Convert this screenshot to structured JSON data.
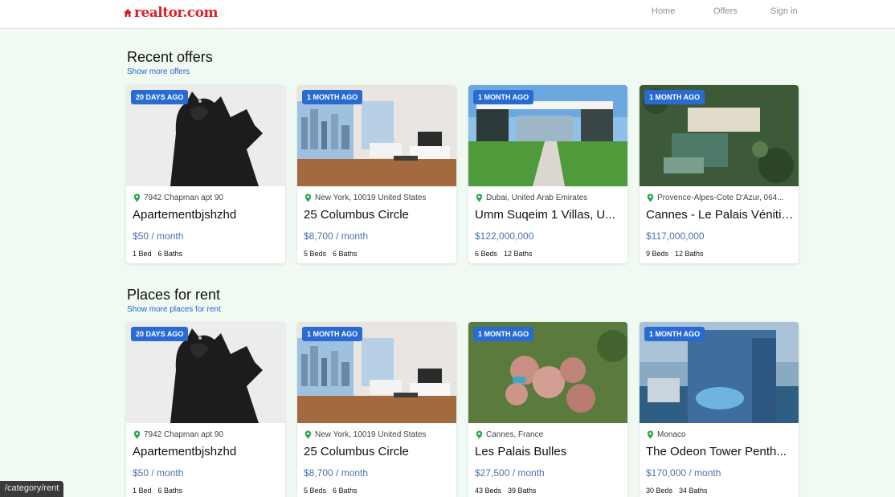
{
  "header": {
    "brand": "realtor.com",
    "nav": [
      "Home",
      "Offers",
      "Sign in"
    ]
  },
  "sections": [
    {
      "title": "Recent offers",
      "link": "Show more offers",
      "cards": [
        {
          "badge": "20 DAYS AGO",
          "location": "7942 Chapman apt 90",
          "title": "Apartementbjshzhd",
          "price": "$50 / month",
          "beds": "1 Bed",
          "baths": "6 Baths",
          "image": "costume-photo"
        },
        {
          "badge": "1 MONTH AGO",
          "location": "New York, 10019 United States",
          "title": "25 Columbus Circle",
          "price": "$8,700 / month",
          "beds": "5 Beds",
          "baths": "6 Baths",
          "image": "apartment-interior-photo"
        },
        {
          "badge": "1 MONTH AGO",
          "location": "Dubai, United Arab Emirates",
          "title": "Umm Suqeim 1 Villas, U...",
          "price": "$122,000,000",
          "beds": "6 Beds",
          "baths": "12 Baths",
          "image": "modern-villa-photo"
        },
        {
          "badge": "1 MONTH AGO",
          "location": "Provence-Alpes-Cote D'Azur, 064...",
          "title": "Cannes - Le Palais Vénitien",
          "price": "$117,000,000",
          "beds": "9 Beds",
          "baths": "12 Baths",
          "image": "palace-aerial-photo"
        }
      ]
    },
    {
      "title": "Places for rent",
      "link": "Show more places for rent",
      "cards": [
        {
          "badge": "20 DAYS AGO",
          "location": "7942 Chapman apt 90",
          "title": "Apartementbjshzhd",
          "price": "$50 / month",
          "beds": "1 Bed",
          "baths": "6 Baths",
          "image": "costume-photo"
        },
        {
          "badge": "1 MONTH AGO",
          "location": "New York, 10019 United States",
          "title": "25 Columbus Circle",
          "price": "$8,700 / month",
          "beds": "5 Beds",
          "baths": "6 Baths",
          "image": "apartment-interior-photo"
        },
        {
          "badge": "1 MONTH AGO",
          "location": "Cannes, France",
          "title": "Les Palais Bulles",
          "price": "$27,500 / month",
          "beds": "43 Beds",
          "baths": "39 Baths",
          "image": "bubble-palace-photo"
        },
        {
          "badge": "1 MONTH AGO",
          "location": "Monaco",
          "title": "The Odeon Tower Penth...",
          "price": "$170,000 / month",
          "beds": "30 Beds",
          "baths": "34 Baths",
          "image": "tower-pool-photo"
        }
      ]
    }
  ],
  "status_bar": "/category/rent",
  "colors": {
    "brand": "#d92228",
    "badge": "#2a6bd3",
    "price": "#4a73b0",
    "link": "#2563c9",
    "pin": "#2aa84a",
    "background": "#f0faf3"
  }
}
